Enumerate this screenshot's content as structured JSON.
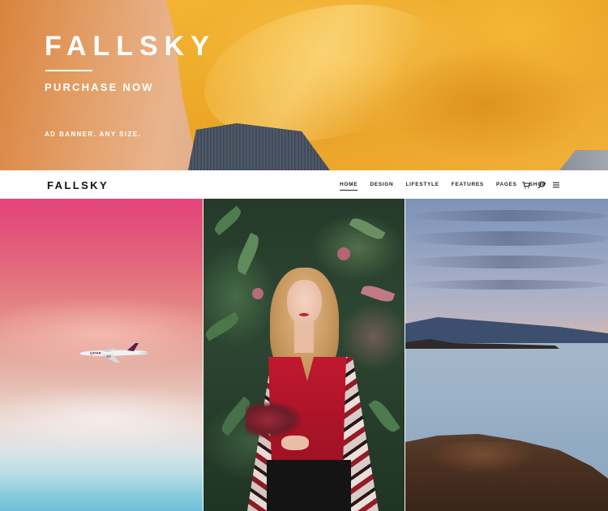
{
  "banner": {
    "title": "FALLSKY",
    "cta": "PURCHASE NOW",
    "caption": "AD BANNER. ANY SIZE."
  },
  "navbar": {
    "logo": "FALLSKY",
    "menu": [
      {
        "label": "HOME",
        "active": true
      },
      {
        "label": "DESIGN",
        "active": false
      },
      {
        "label": "LIFESTYLE",
        "active": false
      },
      {
        "label": "FEATURES",
        "active": false
      },
      {
        "label": "PAGES",
        "active": false
      },
      {
        "label": "SHOP",
        "active": false
      }
    ],
    "icons": [
      "cart-icon",
      "search-icon",
      "hamburger-menu-icon"
    ]
  },
  "grid": {
    "tiles": [
      "sky-with-airplane-photo",
      "woman-portrait-photo",
      "seascape-sunset-photo"
    ]
  },
  "colors": {
    "banner_yellow": "#efad2c",
    "text_dark": "#111111",
    "nav_background": "#ffffff"
  }
}
